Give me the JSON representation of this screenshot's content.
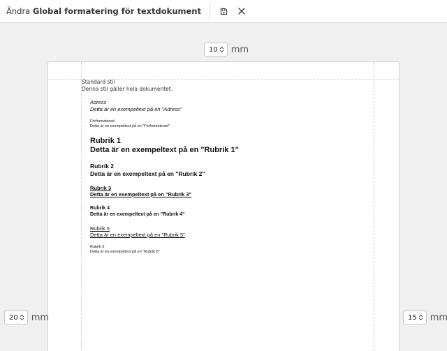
{
  "header": {
    "title_prefix": "Ändra",
    "title_name": "Global formatering för textdokument"
  },
  "margins": {
    "top": {
      "value": "10",
      "unit": "mm"
    },
    "left": {
      "value": "20",
      "unit": "mm"
    },
    "right": {
      "value": "15",
      "unit": "mm"
    }
  },
  "document": {
    "standard_title": "Standard stil",
    "standard_desc": "Denna stil gäller hela dokumentet.",
    "styles": {
      "adress": {
        "name": "Adress",
        "sample": "Detta är en exempeltext på en \"Adress\""
      },
      "forformaterad": {
        "name": "Förformaterad",
        "sample": "Detta är en exempeltext på en \"Förformaterad\""
      },
      "rubrik1": {
        "name": "Rubrik 1",
        "sample": "Detta är en exempeltext på en \"Rubrik 1\""
      },
      "rubrik2": {
        "name": "Rubrik 2",
        "sample": "Detta är en exempeltext på en \"Rubrik 2\""
      },
      "rubrik3": {
        "name": "Rubrik 3",
        "sample": "Detta är en exempeltext på en \"Rubrik 3\""
      },
      "rubrik4": {
        "name": "Rubrik 4",
        "sample": "Detta är en exempeltext på en \"Rubrik 4\""
      },
      "rubrik5": {
        "name": "Rubrik 5",
        "sample": "Detta är en exempeltext på en \"Rubrik 5\""
      },
      "rubrik6": {
        "name": "Rubrik 6",
        "sample": "Detta är en exempeltext på en \"Rubrik 6\""
      }
    }
  }
}
